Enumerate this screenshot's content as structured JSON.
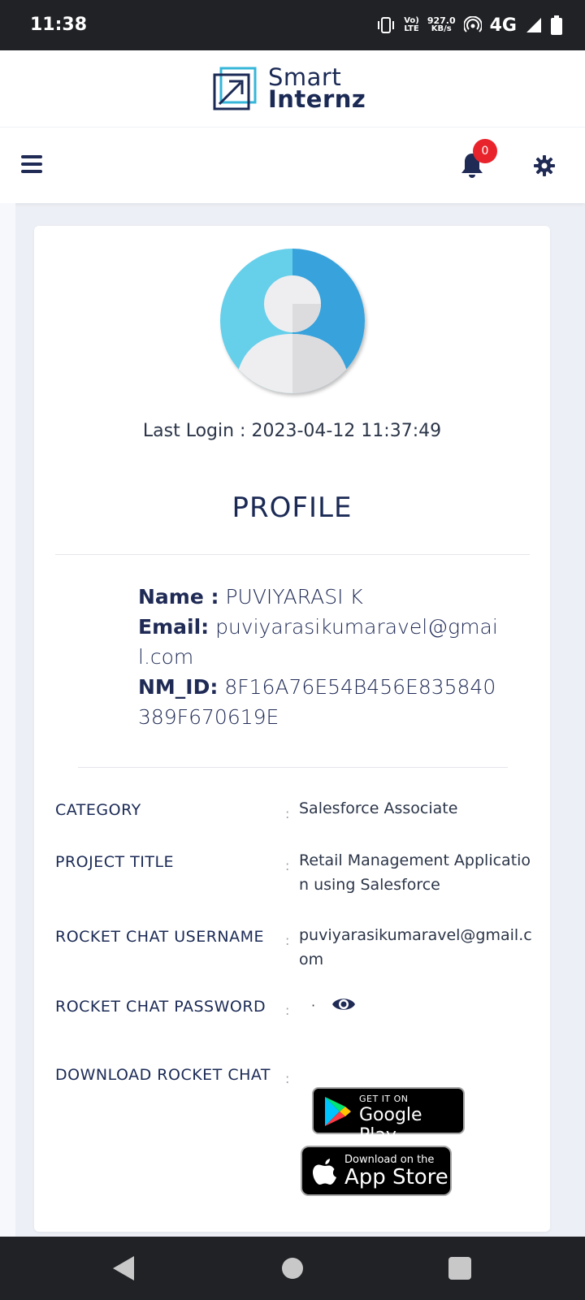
{
  "status_bar": {
    "time": "11:38",
    "lte_top": "Vo)",
    "lte_bottom": "LTE",
    "speed_value": "927.0",
    "speed_unit": "KB/s",
    "network": "4G"
  },
  "brand": {
    "line1": "Smart",
    "line2": "Internz",
    "colors": {
      "navy": "#1b2a55",
      "cyan": "#35b6d9"
    }
  },
  "nav": {
    "menu_icon": "hamburger-icon",
    "notification_icon": "bell-icon",
    "notification_count": "0",
    "settings_icon": "gear-icon"
  },
  "profile": {
    "last_login_label": "Last Login :",
    "last_login_value": "2023-04-12 11:37:49",
    "title": "PROFILE",
    "name_label": "Name :",
    "name_value": "PUVIYARASI K",
    "email_label": "Email:",
    "email_value": "puviyarasikumaravel@gmail.com",
    "nmid_label": "NM_ID:",
    "nmid_value": "8F16A76E54B456E835840389F670619E"
  },
  "details": {
    "category_label": "CATEGORY",
    "category_value": "Salesforce Associate",
    "project_label": "PROJECT TITLE",
    "project_value": "Retail Management Application using Salesforce",
    "rc_user_label": "ROCKET CHAT USERNAME",
    "rc_user_value": "puviyarasikumaravel@gmail.com",
    "rc_pass_label": "ROCKET CHAT PASSWORD",
    "rc_pass_value": "·",
    "download_label": "DOWNLOAD ROCKET CHAT",
    "separator": ":"
  },
  "stores": {
    "gplay_small": "GET IT ON",
    "gplay_big": "Google Play",
    "appstore_small": "Download on the",
    "appstore_big": "App Store"
  }
}
